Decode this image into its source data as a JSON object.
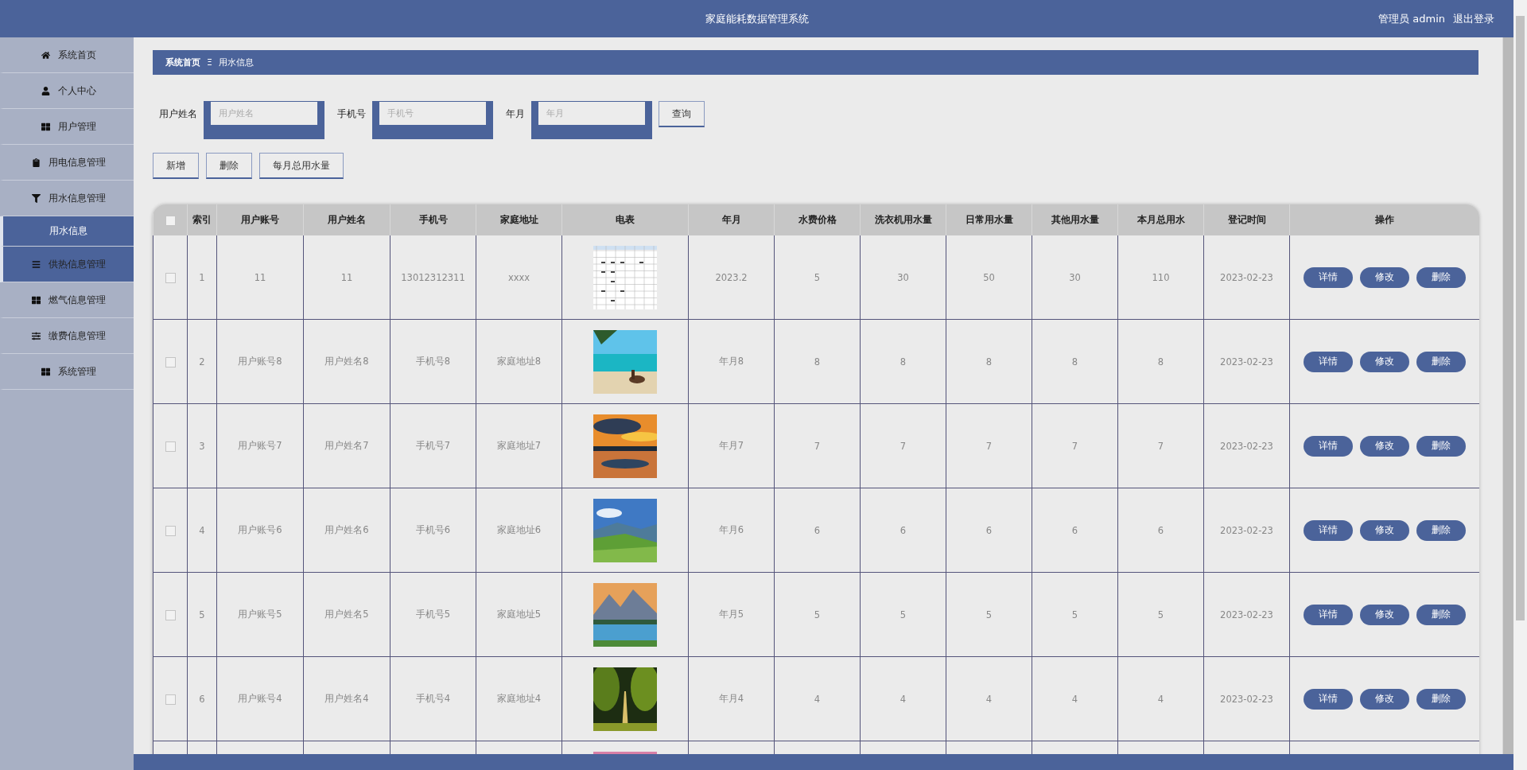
{
  "header": {
    "title": "家庭能耗数据管理系统",
    "user": "管理员 admin",
    "logout": "退出登录"
  },
  "sidebar": {
    "items": [
      {
        "label": "系统首页",
        "kind": "home",
        "hovered": false
      },
      {
        "label": "个人中心",
        "kind": "user",
        "hovered": false
      },
      {
        "label": "用户管理",
        "kind": "grid",
        "hovered": false
      },
      {
        "label": "用电信息管理",
        "kind": "clipboard",
        "hovered": false
      },
      {
        "label": "用水信息管理",
        "kind": "tap",
        "hovered": false,
        "expanded": true,
        "children": [
          {
            "label": "用水信息",
            "selected": true
          }
        ]
      },
      {
        "label": "供热信息管理",
        "kind": "list",
        "hovered": true
      },
      {
        "label": "燃气信息管理",
        "kind": "grid",
        "hovered": false
      },
      {
        "label": "缴费信息管理",
        "kind": "sliders",
        "hovered": false
      },
      {
        "label": "系统管理",
        "kind": "grid",
        "hovered": false
      }
    ]
  },
  "breadcrumb": {
    "items": [
      "系统首页",
      "用水信息"
    ],
    "separator": "Ξ"
  },
  "filters": [
    {
      "label": "用户姓名",
      "placeholder": "用户姓名"
    },
    {
      "label": "手机号",
      "placeholder": "手机号"
    },
    {
      "label": "年月",
      "placeholder": "年月"
    }
  ],
  "search_button": "查询",
  "actions": [
    "新增",
    "删除",
    "每月总用水量"
  ],
  "table": {
    "header_checkbox": {
      "checked": false
    },
    "columns": [
      "索引",
      "用户账号",
      "用户姓名",
      "手机号",
      "家庭地址",
      "电表",
      "年月",
      "水费价格",
      "洗衣机用水量",
      "日常用水量",
      "其他用水量",
      "本月总用水",
      "登记时间",
      "操作"
    ],
    "rows": [
      {
        "checked": false,
        "cells": [
          "1",
          "11",
          "11",
          "13012312311",
          "xxxx"
        ],
        "meter": {
          "kind": "sheet"
        },
        "rest": [
          "2023.2",
          "5",
          "30",
          "50",
          "30",
          "110",
          "2023-02-23"
        ],
        "buttons": [
          "详情",
          "修改",
          "删除"
        ]
      },
      {
        "checked": false,
        "cells": [
          "2",
          "用户账号8",
          "用户姓名8",
          "手机号8",
          "家庭地址8"
        ],
        "meter": {
          "kind": "picture"
        },
        "rest": [
          "年月8",
          "8",
          "8",
          "8",
          "8",
          "8",
          "2023-02-23"
        ],
        "buttons": [
          "详情",
          "修改",
          "删除"
        ]
      },
      {
        "checked": false,
        "cells": [
          "3",
          "用户账号7",
          "用户姓名7",
          "手机号7",
          "家庭地址7"
        ],
        "meter": {
          "kind": "picture"
        },
        "rest": [
          "年月7",
          "7",
          "7",
          "7",
          "7",
          "7",
          "2023-02-23"
        ],
        "buttons": [
          "详情",
          "修改",
          "删除"
        ]
      },
      {
        "checked": false,
        "cells": [
          "4",
          "用户账号6",
          "用户姓名6",
          "手机号6",
          "家庭地址6"
        ],
        "meter": {
          "kind": "picture"
        },
        "rest": [
          "年月6",
          "6",
          "6",
          "6",
          "6",
          "6",
          "2023-02-23"
        ],
        "buttons": [
          "详情",
          "修改",
          "删除"
        ]
      },
      {
        "checked": false,
        "cells": [
          "5",
          "用户账号5",
          "用户姓名5",
          "手机号5",
          "家庭地址5"
        ],
        "meter": {
          "kind": "picture"
        },
        "rest": [
          "年月5",
          "5",
          "5",
          "5",
          "5",
          "5",
          "2023-02-23"
        ],
        "buttons": [
          "详情",
          "修改",
          "删除"
        ]
      },
      {
        "checked": false,
        "cells": [
          "6",
          "用户账号4",
          "用户姓名4",
          "手机号4",
          "家庭地址4"
        ],
        "meter": {
          "kind": "picture"
        },
        "rest": [
          "年月4",
          "4",
          "4",
          "4",
          "4",
          "4",
          "2023-02-23"
        ],
        "buttons": [
          "详情",
          "修改",
          "删除"
        ]
      },
      {
        "meter": {
          "kind": "picture"
        }
      }
    ]
  }
}
